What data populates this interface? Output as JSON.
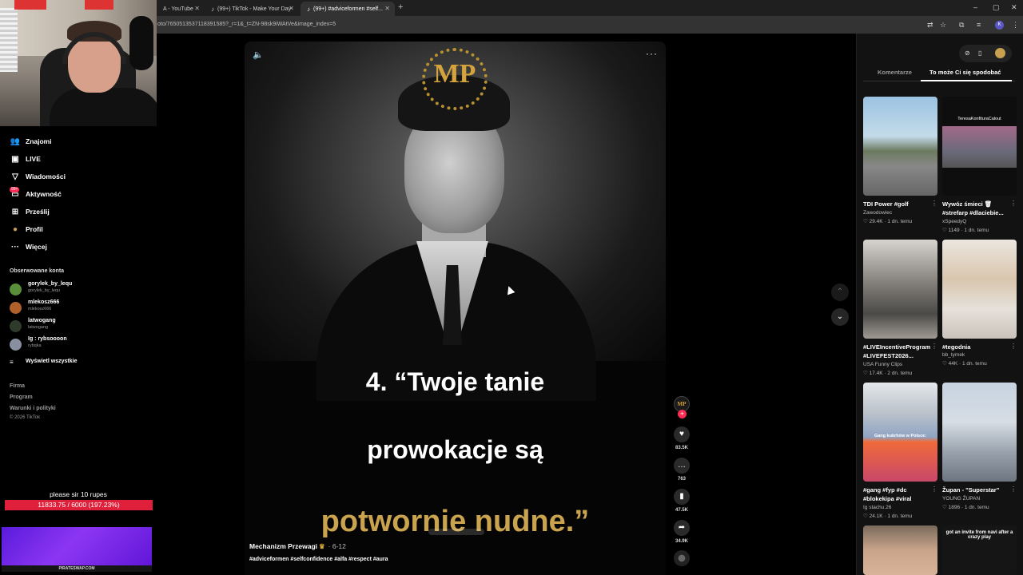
{
  "browser": {
    "tabs": [
      {
        "label": "A - YouTube"
      },
      {
        "label": "(99+) TikTok - Make Your Day"
      },
      {
        "label": "(99+) #adviceformen #self..."
      }
    ],
    "url": "oto/7650513537118391585?_r=1&_t=ZN-98sk9iWAtVe&image_index=5"
  },
  "sidebar": {
    "items": [
      {
        "label": "Znajomi",
        "icon": "friends-icon"
      },
      {
        "label": "LIVE",
        "icon": "live-icon"
      },
      {
        "label": "Wiadomości",
        "icon": "messages-icon"
      },
      {
        "label": "Aktywność",
        "icon": "activity-icon"
      },
      {
        "label": "Prześlij",
        "icon": "upload-icon"
      },
      {
        "label": "Profil",
        "icon": "profile-icon"
      },
      {
        "label": "Więcej",
        "icon": "more-icon"
      }
    ],
    "activity_badge": "99+",
    "followed_title": "Obserwowane konta",
    "accounts": [
      {
        "name": "gorylek_by_lequ",
        "handle": "gorylek_by_lequ",
        "color": "#5a8f3a"
      },
      {
        "name": "mlekosz666",
        "handle": "mlekosz666",
        "color": "#b0602a"
      },
      {
        "name": "latwogang",
        "handle": "latwogang",
        "color": "#2e3b2a"
      },
      {
        "name": "Ig : rybsoooon",
        "handle": "rybqka",
        "color": "#8890a0"
      }
    ],
    "show_all": "Wyświetl wszystkie",
    "footer": [
      "Firma",
      "Program",
      "Warunki i polityki",
      "© 2026 TikTok"
    ]
  },
  "overlay": {
    "goal_label": "please sir 10 rupes",
    "goal_text": "11833.75 / 6000 (197.23%)",
    "goal_progress": 1.0,
    "promo_label": "PIRATESWAP.COM"
  },
  "video": {
    "logo": "MP",
    "quote_line1": "4. “Twoje tanie",
    "quote_line2": "prowokacje są",
    "quote_line3": "potwornie nudne.”",
    "author": "Mechanizm Przewagi",
    "date": "· 6-12",
    "hashtags": "#adviceformen #selfconfidence #alfa #respect #aura"
  },
  "actions": {
    "avatar": "MP",
    "likes": "83.5K",
    "comments": "763",
    "saves": "47.5K",
    "shares": "34.9K"
  },
  "rightpanel": {
    "tabs": [
      "Komentarze",
      "To może Ci się spodobać"
    ],
    "videos": [
      {
        "title": "TDI Power #golf",
        "author": "Zawodowiec",
        "meta": "♡ 29.4K · 1 dn. temu",
        "thumb_text": ""
      },
      {
        "title": "Wywóz śmieci 🗑 #strefarp #dlaciebie...",
        "author": "xSpeedyQ",
        "meta": "♡ 1149 · 1 dn. temu",
        "thumb_text": "TeresaKonfituraCalout"
      },
      {
        "title": "#LIVEIncentiveProgram #LIVEFEST2026...",
        "author": "USA Funny Clips",
        "meta": "♡ 17.4K · 2 dn. temu",
        "thumb_text": ""
      },
      {
        "title": "#tegodnia",
        "author": "bb_tymek",
        "meta": "♡ 44K · 1 dn. temu",
        "thumb_text": ""
      },
      {
        "title": "#gang #fyp #dc #blokekipa #viral",
        "author": "Ig stachu.26",
        "meta": "♡ 24.1K · 1 dn. temu",
        "thumb_text": "Gang kukrhów w Polsce:"
      },
      {
        "title": "Župan - \"Superstar\"",
        "author": "YOUNG ŽUPAN",
        "meta": "♡ 1896 · 1 dn. temu",
        "thumb_text": ""
      },
      {
        "title": "",
        "author": "",
        "meta": "",
        "thumb_text": ""
      },
      {
        "title": "",
        "author": "",
        "meta": "",
        "thumb_text": "got an invite from navi after a crazy play"
      }
    ]
  },
  "colors": {
    "accent": "#fe2c55",
    "gold": "#c9a34e"
  }
}
